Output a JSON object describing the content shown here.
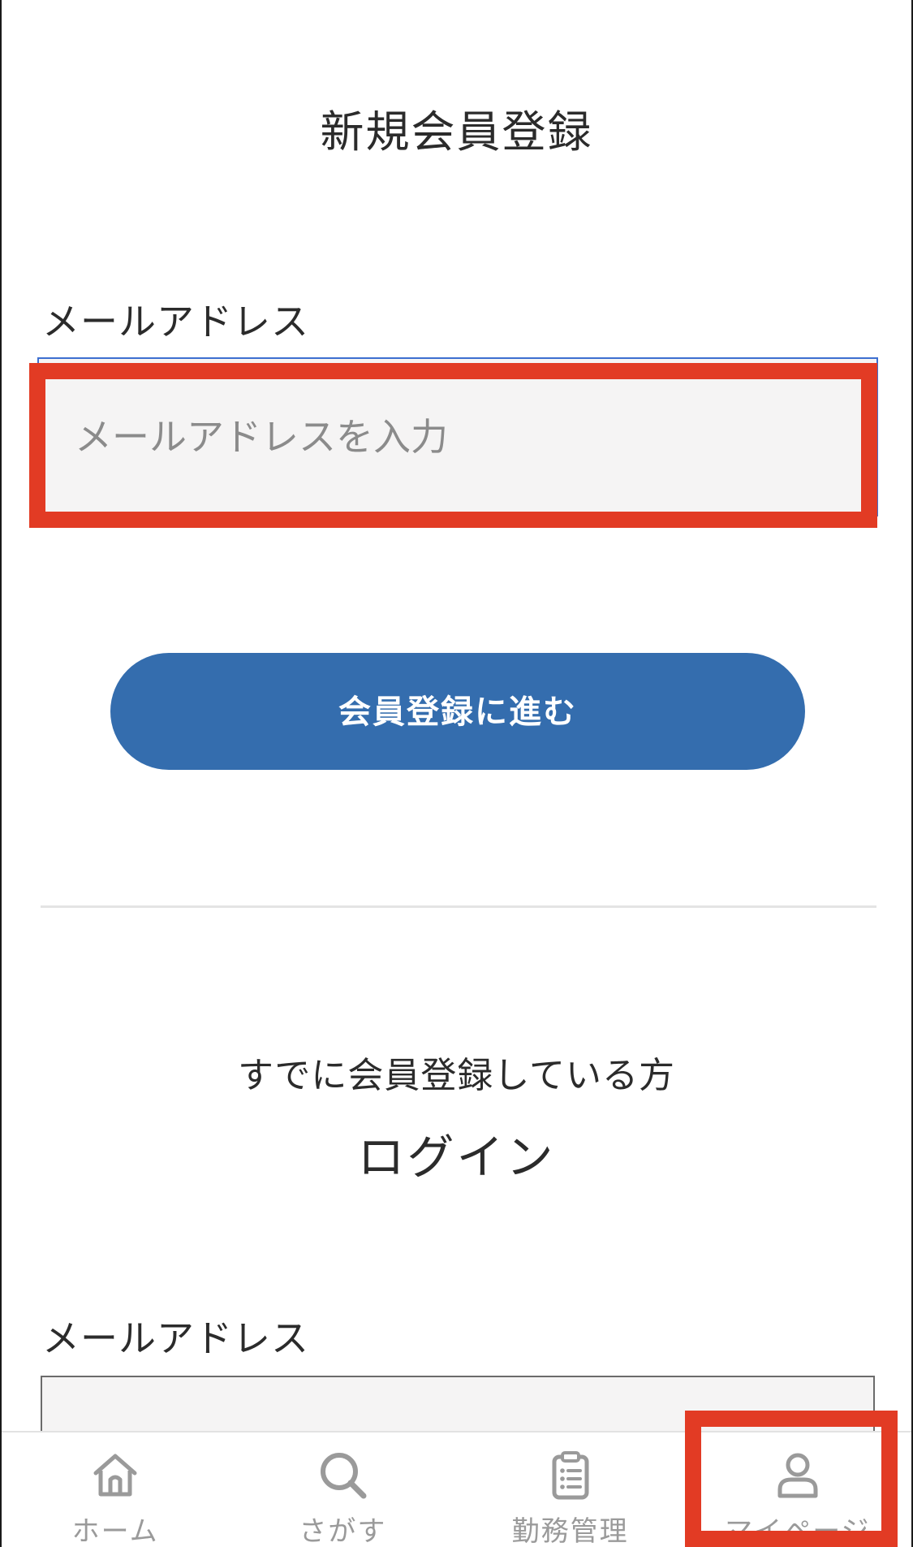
{
  "page_title": "新規会員登録",
  "register": {
    "email_label": "メールアドレス",
    "email_placeholder": "メールアドレスを入力",
    "email_value": "",
    "submit_label": "会員登録に進む"
  },
  "login": {
    "prompt": "すでに会員登録している方",
    "title": "ログイン",
    "email_label": "メールアドレス",
    "email_value": ""
  },
  "tabbar": {
    "items": [
      {
        "label": "ホーム",
        "icon": "home-icon"
      },
      {
        "label": "さがす",
        "icon": "search-icon"
      },
      {
        "label": "勤務管理",
        "icon": "clipboard-icon"
      },
      {
        "label": "マイページ",
        "icon": "user-icon"
      }
    ]
  },
  "colors": {
    "primary_button": "#346dae",
    "highlight": "#e23b24",
    "input_bg": "#f5f4f4",
    "tab_inactive": "#9a9a9a"
  }
}
